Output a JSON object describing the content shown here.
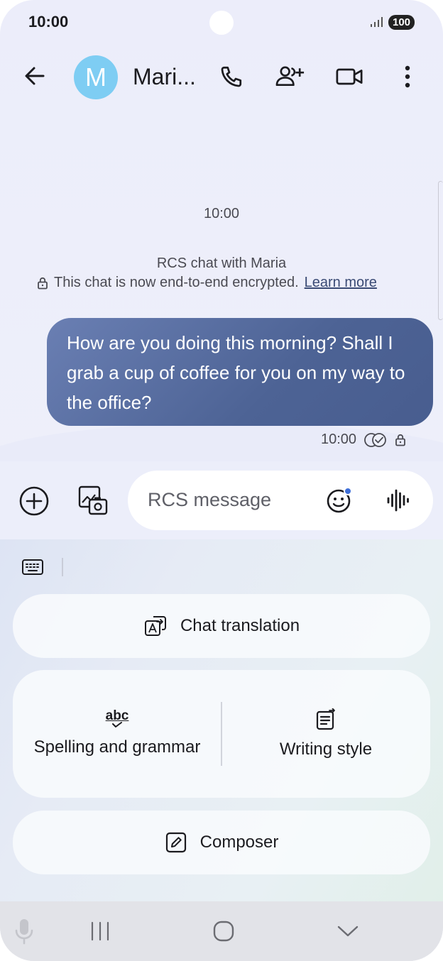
{
  "status_bar": {
    "time": "10:00",
    "battery": "100"
  },
  "header": {
    "avatar_letter": "M",
    "contact_name": "Mari..."
  },
  "conversation": {
    "timestamp": "10:00",
    "rcs_info": "RCS chat with Maria",
    "encryption_text": "This chat is now end-to-end encrypted.",
    "learn_more": "Learn more",
    "message": {
      "text": "How are you doing this morning? Shall I grab a cup of coffee for you on my way to the office?",
      "time": "10:00"
    }
  },
  "composer": {
    "placeholder": "RCS message"
  },
  "ai_panel": {
    "chat_translation": "Chat translation",
    "spelling_grammar": "Spelling and grammar",
    "spelling_icon_text": "abc",
    "writing_style": "Writing style",
    "composer": "Composer"
  },
  "colors": {
    "bubble": "#53699b",
    "avatar": "#7ecdf3",
    "accent_dot": "#3f6fd8"
  }
}
